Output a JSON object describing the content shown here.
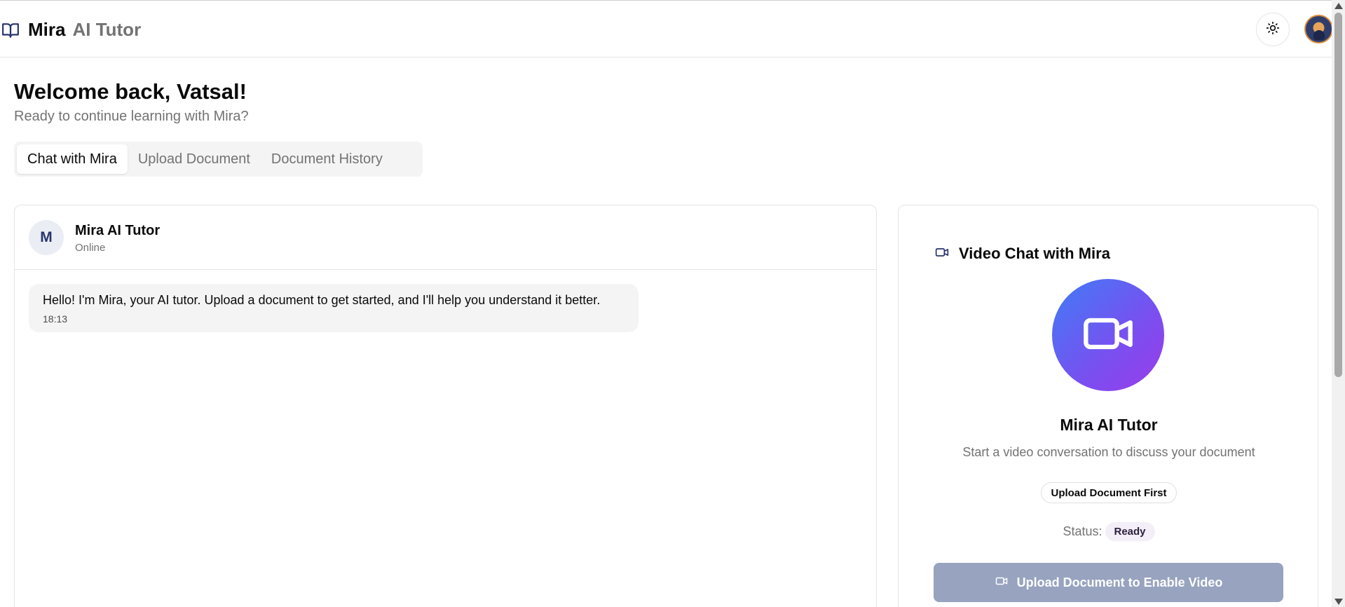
{
  "header": {
    "brand_name": "Mira",
    "brand_sub": "AI Tutor",
    "brand_icon": "open-book-icon",
    "theme_icon": "sun-icon",
    "avatar_icon": "user-avatar"
  },
  "welcome": {
    "title": "Welcome back, Vatsal!",
    "subtitle": "Ready to continue learning with Mira?"
  },
  "tabs": [
    {
      "label": "Chat with Mira",
      "active": true
    },
    {
      "label": "Upload Document",
      "active": false
    },
    {
      "label": "Document History",
      "active": false
    }
  ],
  "chat": {
    "avatar_initial": "M",
    "name": "Mira AI Tutor",
    "status": "Online",
    "messages": [
      {
        "text": "Hello! I'm Mira, your AI tutor. Upload a document to get started, and I'll help you understand it better.",
        "time": "18:13"
      }
    ]
  },
  "video": {
    "title": "Video Chat with Mira",
    "title_icon": "video-camera-icon",
    "name": "Mira AI Tutor",
    "description": "Start a video conversation to discuss your document",
    "badge": "Upload Document First",
    "status_label": "Status:",
    "status_value": "Ready",
    "button_label": "Upload Document to Enable Video",
    "button_icon": "video-camera-icon"
  },
  "colors": {
    "accent_navy": "#27346b",
    "gradient_start": "#3f7cf6",
    "gradient_end": "#9a3ce8",
    "disabled_button": "#97a3bf"
  }
}
